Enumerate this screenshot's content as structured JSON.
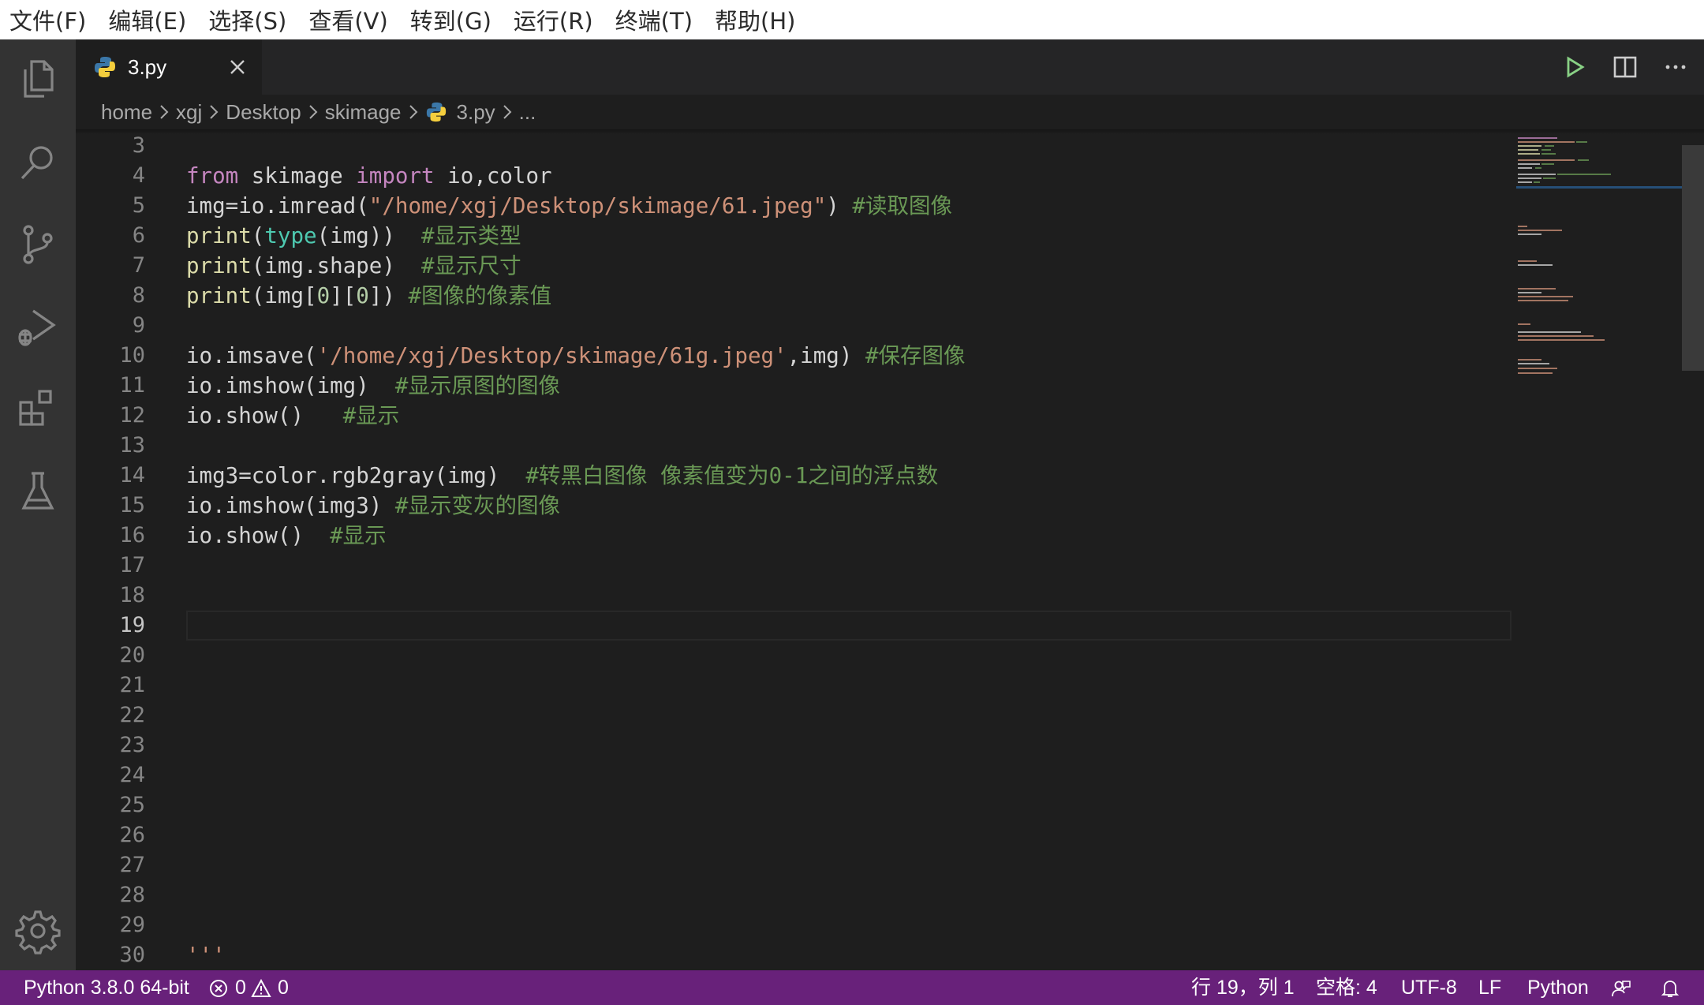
{
  "menu": [
    "文件(F)",
    "编辑(E)",
    "选择(S)",
    "查看(V)",
    "转到(G)",
    "运行(R)",
    "终端(T)",
    "帮助(H)"
  ],
  "activity_bar": [
    "files-icon",
    "search-icon",
    "source-control-icon",
    "run-debug-icon",
    "extensions-icon",
    "testing-flask-icon",
    "settings-gear-icon"
  ],
  "tab": {
    "label": "3.py",
    "icon": "python-icon"
  },
  "editor_actions": [
    "run-icon",
    "split-editor-icon",
    "more-actions-icon"
  ],
  "breadcrumb": [
    "home",
    "xgj",
    "Desktop",
    "skimage",
    "3.py",
    "..."
  ],
  "editor": {
    "line_numbers": [
      "3",
      "4",
      "5",
      "6",
      "7",
      "8",
      "9",
      "10",
      "11",
      "12",
      "13",
      "14",
      "15",
      "16",
      "17",
      "18",
      "19",
      "20",
      "21",
      "22",
      "23",
      "24",
      "25",
      "26",
      "27",
      "28",
      "29",
      "30"
    ],
    "lines": {
      "l4": [
        "from",
        " skimage ",
        "import",
        " io,color"
      ],
      "l5": [
        "img=io.imread(",
        "\"/home/xgj/Desktop/skimage/61.jpeg\"",
        ") ",
        "#读取图像"
      ],
      "l6": [
        "print",
        "(",
        "type",
        "(img))  ",
        "#显示类型"
      ],
      "l7": [
        "print",
        "(img.shape)  ",
        "#显示尺寸"
      ],
      "l8": [
        "print",
        "(img[",
        "0",
        "][",
        "0",
        "]) ",
        "#图像的像素值"
      ],
      "l10": [
        "io.imsave(",
        "'/home/xgj/Desktop/skimage/61g.jpeg'",
        ",img) ",
        "#保存图像"
      ],
      "l11": [
        "io.imshow(img)  ",
        "#显示原图的图像"
      ],
      "l12": [
        "io.show()   ",
        "#显示"
      ],
      "l14": [
        "img3=color.rgb2gray(img)  ",
        "#转黑白图像 像素值变为0-1之间的浮点数"
      ],
      "l15": [
        "io.imshow(img3) ",
        "#显示变灰的图像"
      ],
      "l16": [
        "io.show()  ",
        "#显示"
      ],
      "l30": [
        "'''"
      ]
    },
    "current_line": 19
  },
  "status_bar": {
    "interpreter": "Python 3.8.0 64-bit",
    "errors": "0",
    "warnings": "0",
    "cursor": "行 19，列 1",
    "spaces": "空格: 4",
    "encoding": "UTF-8",
    "eol": "LF",
    "language": "Python"
  },
  "colors": {
    "status_bar": "#68217a",
    "editor_bg": "#1e1e1e",
    "keyword": "#c586c0",
    "string": "#ce9178",
    "comment": "#6a9955",
    "function": "#dcdcaa"
  }
}
